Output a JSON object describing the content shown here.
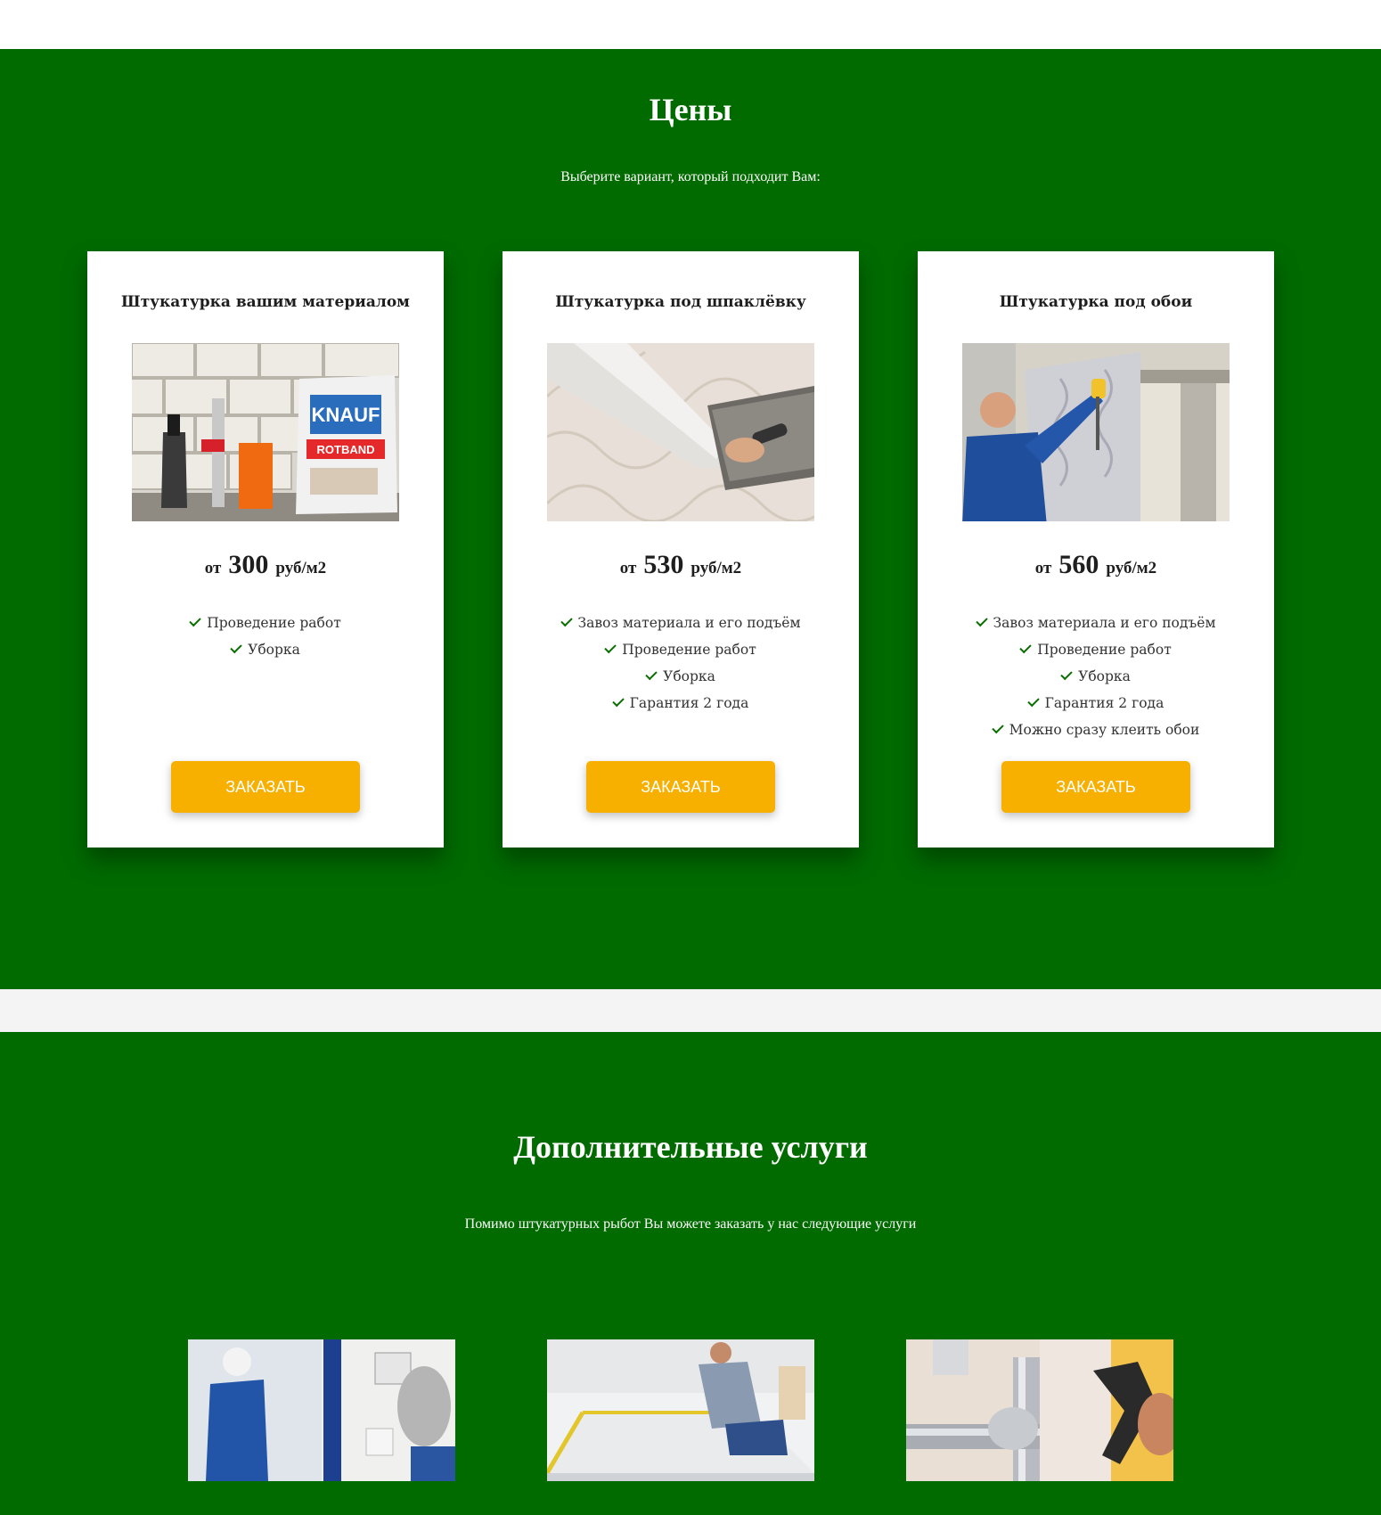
{
  "prices": {
    "title": "Цены",
    "subtitle": "Выберите вариант, который подходит Вам:",
    "cards": [
      {
        "title": "Штукатурка вашим материалом",
        "price_prefix": "от",
        "price": "300",
        "price_unit": "руб/м2",
        "features": [
          "Проведение работ",
          "Уборка"
        ],
        "button": "ЗАКАЗАТЬ"
      },
      {
        "title": "Штукатурка под шпаклёвку",
        "price_prefix": "от",
        "price": "530",
        "price_unit": "руб/м2",
        "features": [
          "Завоз материала и его подъём",
          "Проведение работ",
          "Уборка",
          "Гарантия 2 года"
        ],
        "button": "ЗАКАЗАТЬ"
      },
      {
        "title": "Штукатурка под обои",
        "price_prefix": "от",
        "price": "560",
        "price_unit": "руб/м2",
        "features": [
          "Завоз материала и его подъём",
          "Проведение работ",
          "Уборка",
          "Гарантия 2 года",
          "Можно сразу клеить обои"
        ],
        "button": "ЗАКАЗАТЬ"
      }
    ],
    "image_labels": {
      "bag_brand": "KNAUF",
      "bag_product": "ROTBAND"
    }
  },
  "extras": {
    "title": "Дополнительные услуги",
    "subtitle": "Помимо штукатурных рыбот Вы можете заказать у нас следующие услуги"
  },
  "colors": {
    "section_bg": "#016b00",
    "button_bg": "#f8b000",
    "check": "#0a6f00"
  }
}
